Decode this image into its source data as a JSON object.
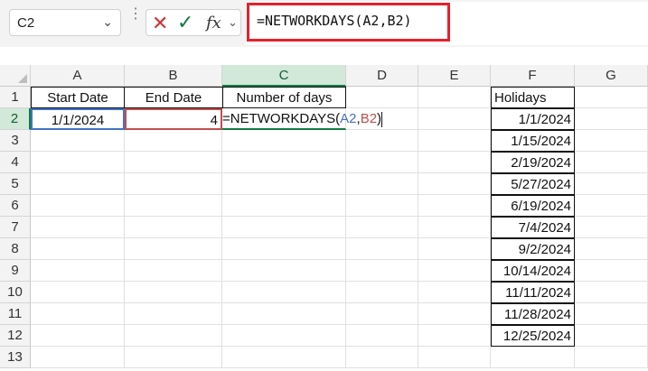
{
  "name_box": {
    "value": "C2"
  },
  "formula_bar": {
    "icons": {
      "cancel": "cancel-x-icon",
      "enter": "checkmark-icon",
      "function": "fx-icon"
    },
    "fx_label": "fx",
    "formula": "=NETWORKDAYS(A2,B2)",
    "highlight_color": "#e8202c"
  },
  "columns": [
    "A",
    "B",
    "C",
    "D",
    "E",
    "F",
    "G"
  ],
  "rows": [
    "1",
    "2",
    "3",
    "4",
    "5",
    "6",
    "7",
    "8",
    "9",
    "10",
    "11",
    "12",
    "13"
  ],
  "cells": {
    "A1": "Start Date",
    "B1": "End Date",
    "C1": "Number of days",
    "A2": "1/1/2024",
    "B2": "4",
    "C2_parts": {
      "prefix": "=NETWORKDAYS(",
      "ref1": "A2",
      "sep": ",",
      "ref2": "B2",
      "suffix": ")"
    },
    "F1": "Holidays"
  },
  "holidays": [
    "1/1/2024",
    "1/15/2024",
    "2/19/2024",
    "5/27/2024",
    "6/19/2024",
    "7/4/2024",
    "9/2/2024",
    "10/14/2024",
    "11/11/2024",
    "11/28/2024",
    "12/25/2024"
  ],
  "colors": {
    "ref_a": "#4472c4",
    "ref_b": "#c0504d",
    "selection": "#107c41"
  }
}
